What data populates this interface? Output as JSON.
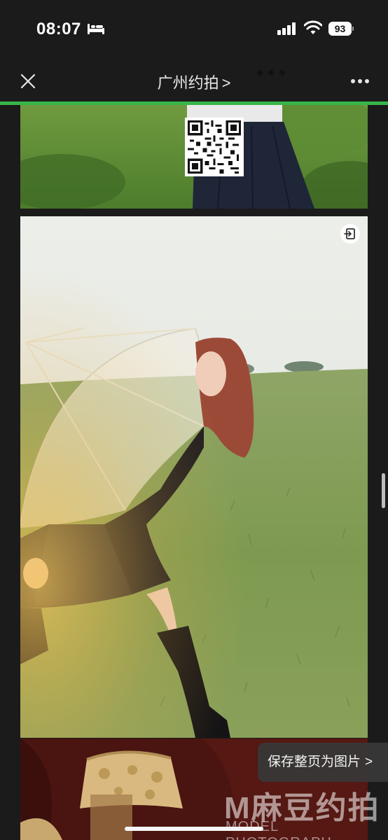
{
  "status_bar": {
    "time": "08:07",
    "battery": "93",
    "icons": [
      "bed-icon",
      "cellular-signal-icon",
      "wifi-icon",
      "battery-icon"
    ]
  },
  "nav": {
    "title": "广州约拍",
    "title_chevron": ">",
    "icons": [
      "close-icon",
      "drag-handle-dots-icon",
      "more-icon"
    ]
  },
  "load_progress": 1.0,
  "actions": {
    "save_label": "保存整页为图片",
    "save_chevron": ">"
  },
  "watermark": {
    "brand": "M麻豆约拍",
    "sub": "MODEL PHOTOGRAPH"
  },
  "colors": {
    "background": "#1b1b1b",
    "progress": "#39b54a",
    "grass": "#7d9a4e",
    "sky": "#e9eae6"
  }
}
